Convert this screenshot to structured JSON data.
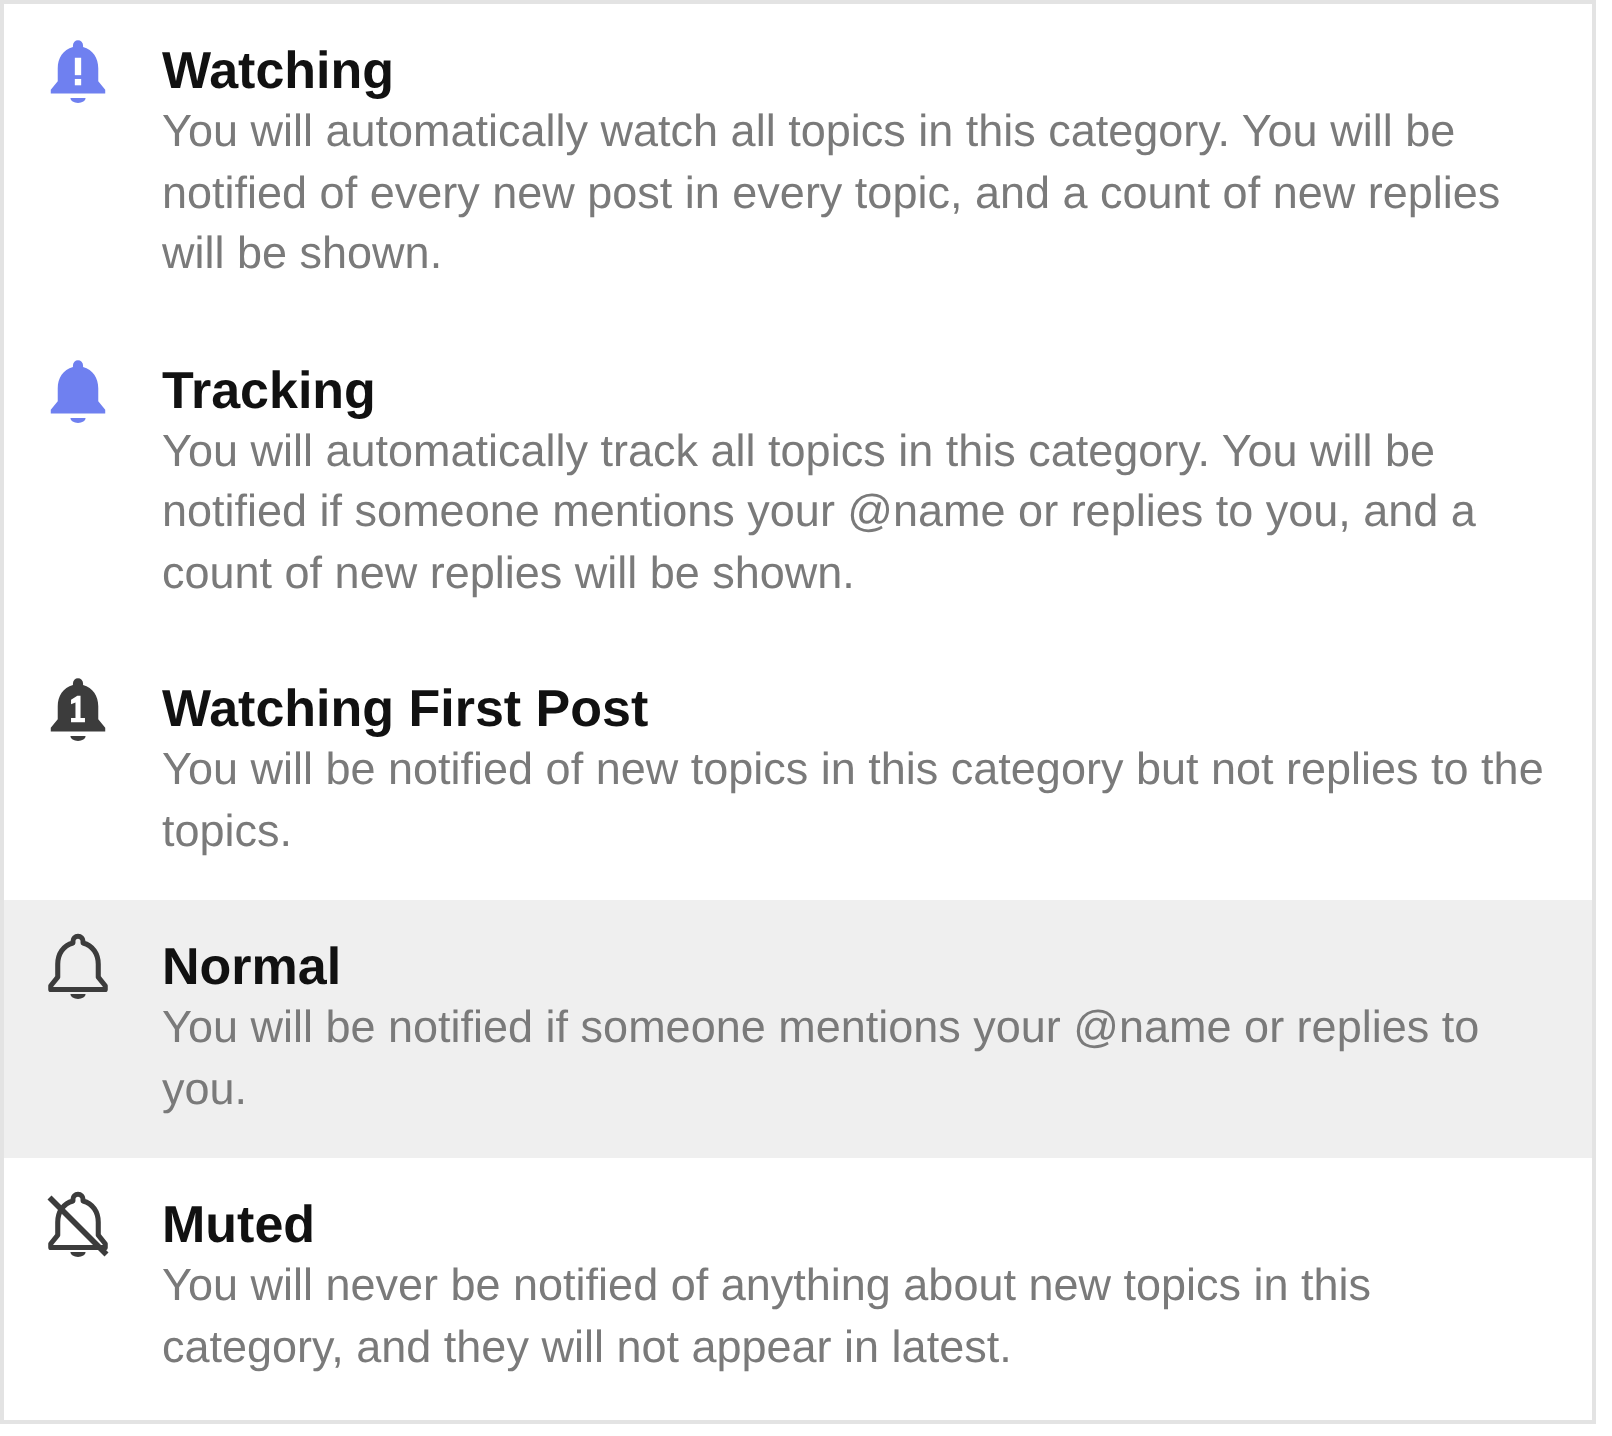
{
  "items": [
    {
      "kind": "watching",
      "title": "Watching",
      "description": "You will automatically watch all topics in this category. You will be notified of every new post in every topic, and a count of new replies will be shown.",
      "selected": false
    },
    {
      "kind": "tracking",
      "title": "Tracking",
      "description": "You will automatically track all topics in this category. You will be notified if someone mentions your @name or replies to you, and a count of new replies will be shown.",
      "selected": false
    },
    {
      "kind": "watching_first_post",
      "title": "Watching First Post",
      "description": "You will be notified of new topics in this category but not replies to the topics.",
      "selected": false
    },
    {
      "kind": "normal",
      "title": "Normal",
      "description": "You will be notified if someone mentions your @name or replies to you.",
      "selected": true
    },
    {
      "kind": "muted",
      "title": "Muted",
      "description": "You will never be notified of anything about new topics in this category, and they will not appear in latest.",
      "selected": false
    }
  ]
}
